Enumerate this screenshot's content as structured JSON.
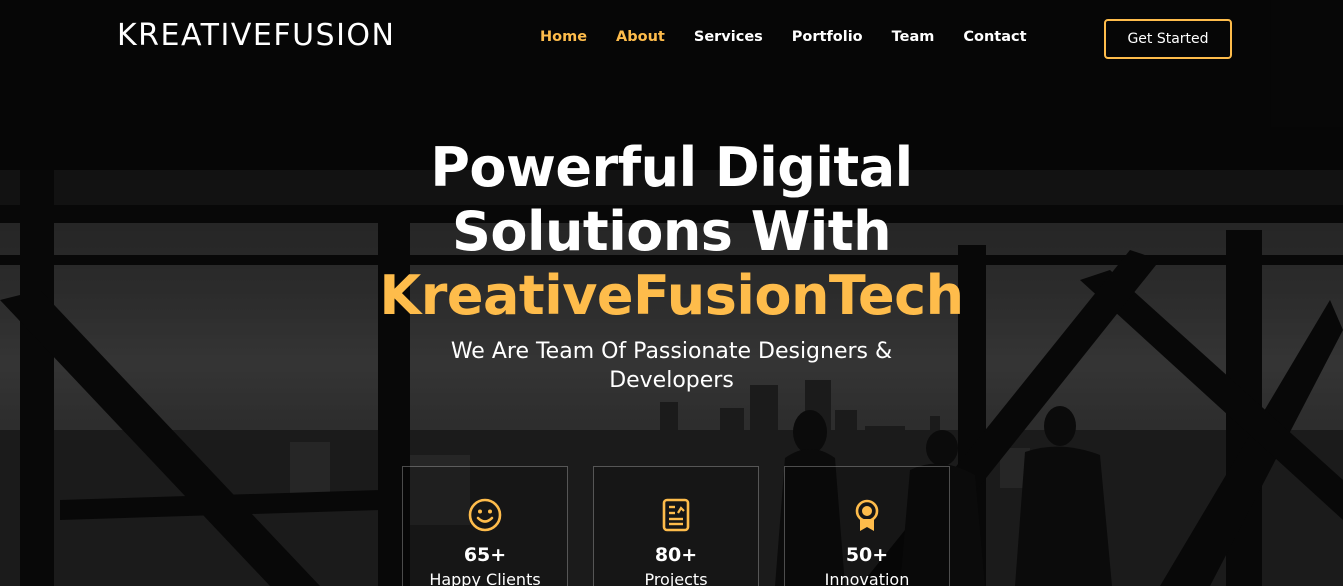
{
  "brand": {
    "logo_text": "KREATIVEFUSION",
    "accent_color": "#febc4b"
  },
  "nav": {
    "items": [
      {
        "label": "Home",
        "active": true
      },
      {
        "label": "About",
        "active": true
      },
      {
        "label": "Services",
        "active": false
      },
      {
        "label": "Portfolio",
        "active": false
      },
      {
        "label": "Team",
        "active": false
      },
      {
        "label": "Contact",
        "active": false
      }
    ],
    "cta_label": "Get Started"
  },
  "hero": {
    "title_line1": "Powerful Digital",
    "title_line2": "Solutions With",
    "title_accent": "KreativeFusionTech",
    "subtitle_line1": "We Are Team Of Passionate Designers &",
    "subtitle_line2": "Developers"
  },
  "stats": [
    {
      "icon": "smile-icon",
      "value": "65+",
      "label": "Happy Clients"
    },
    {
      "icon": "projects-icon",
      "value": "80+",
      "label": "Projects"
    },
    {
      "icon": "award-icon",
      "value": "50+",
      "label": "Innovation"
    }
  ]
}
